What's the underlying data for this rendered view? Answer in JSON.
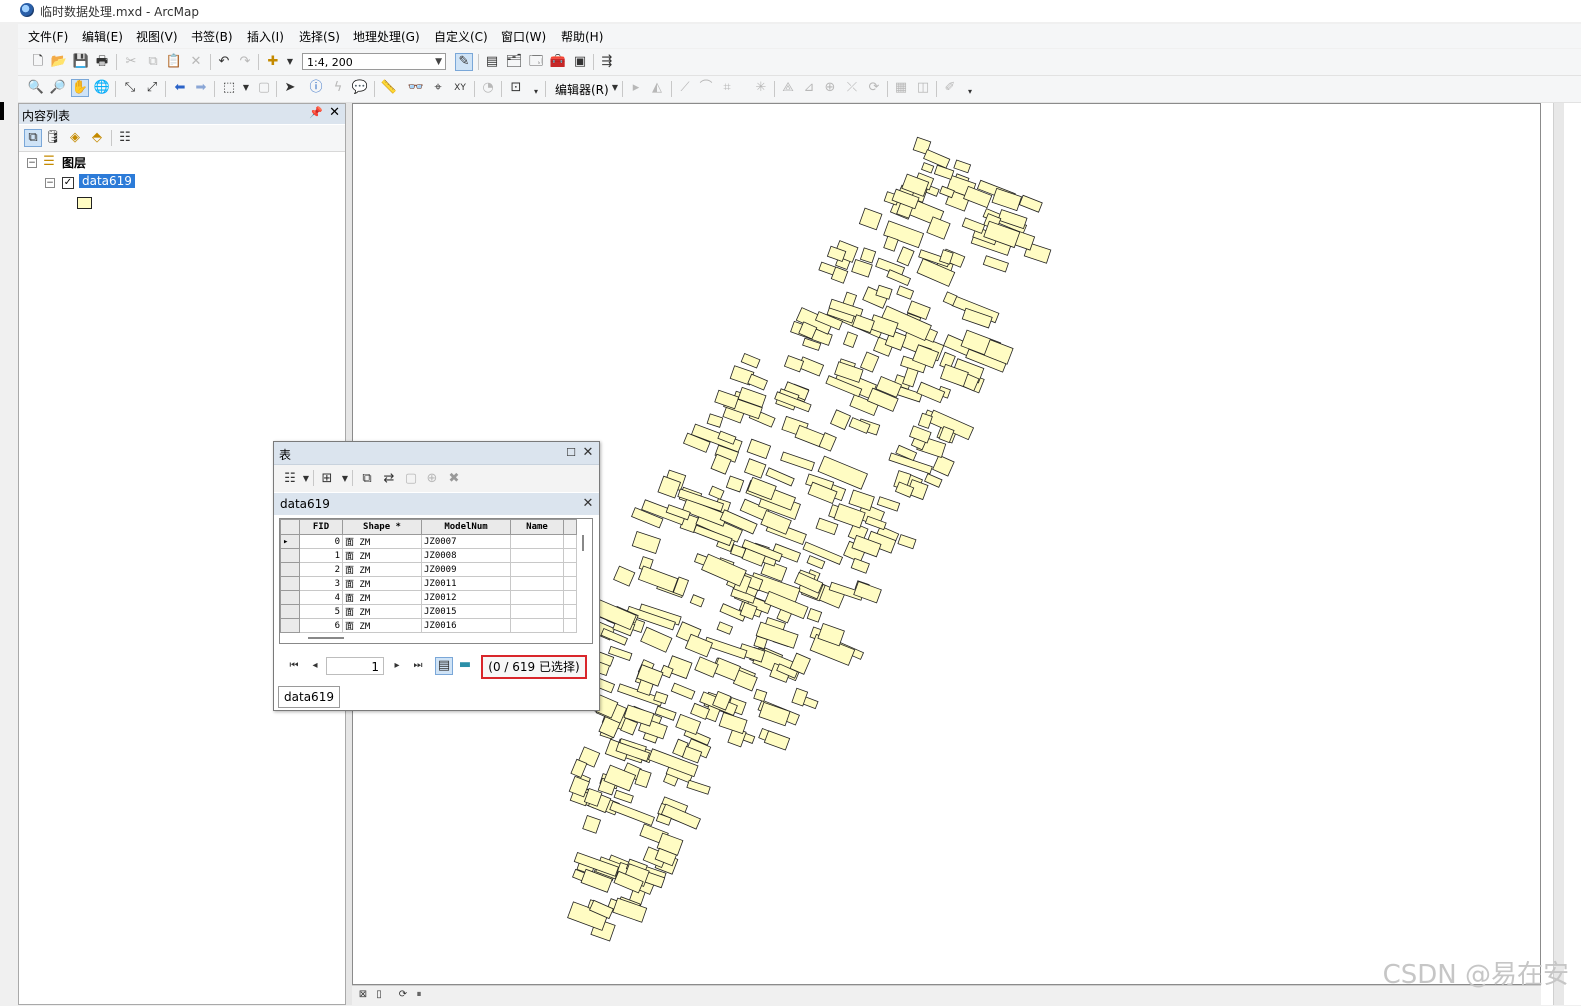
{
  "window": {
    "title": "临时数据处理.mxd - ArcMap"
  },
  "menu": [
    "文件(F)",
    "编辑(E)",
    "视图(V)",
    "书签(B)",
    "插入(I)",
    "选择(S)",
    "地理处理(G)",
    "自定义(C)",
    "窗口(W)",
    "帮助(H)"
  ],
  "toolbar": {
    "scale": "1:4, 200",
    "editor_label": "编辑器(R)"
  },
  "toc": {
    "title": "内容列表",
    "group": "图层",
    "layer": "data619",
    "symbol_color": "#fffcc3"
  },
  "table_window": {
    "title": "表",
    "tab_title": "data619",
    "columns": [
      "FID",
      "Shape *",
      "ModelNum",
      "Name"
    ],
    "rows": [
      {
        "fid": "0",
        "shape": "面 ZM",
        "model": "JZ0007",
        "name": ""
      },
      {
        "fid": "1",
        "shape": "面 ZM",
        "model": "JZ0008",
        "name": ""
      },
      {
        "fid": "2",
        "shape": "面 ZM",
        "model": "JZ0009",
        "name": ""
      },
      {
        "fid": "3",
        "shape": "面 ZM",
        "model": "JZ0011",
        "name": ""
      },
      {
        "fid": "4",
        "shape": "面 ZM",
        "model": "JZ0012",
        "name": ""
      },
      {
        "fid": "5",
        "shape": "面 ZM",
        "model": "JZ0015",
        "name": ""
      },
      {
        "fid": "6",
        "shape": "面 ZM",
        "model": "JZ0016",
        "name": ""
      }
    ],
    "page": "1",
    "selection_status": "(0 / 619 已选择)",
    "footer_tab": "data619"
  },
  "colors": {
    "feature_fill": "#fffcc3",
    "feature_stroke": "#222222",
    "highlight": "#d9262b",
    "selection": "#2c7bd8"
  },
  "watermark": "CSDN @易在安"
}
